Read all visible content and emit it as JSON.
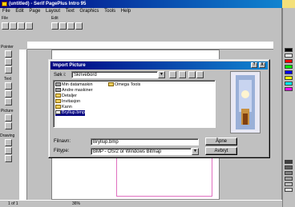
{
  "app": {
    "title": "(untitled) - Serif PagePlus Intro 95",
    "menu": [
      "File",
      "Edit",
      "Page",
      "Layout",
      "Text",
      "Graphics",
      "Tools",
      "Help"
    ],
    "toolbar_groups": [
      "File",
      "Edit"
    ]
  },
  "left_panel": {
    "sections": [
      "Pointer",
      "Text",
      "Picture",
      "Drawing"
    ]
  },
  "status": {
    "page_indicator": "1 of 1",
    "zoom": "36%"
  },
  "dialog": {
    "title": "Import Picture",
    "look_in_label": "Søk i:",
    "look_in_value": "Skrivebord",
    "items": [
      {
        "name": "Min datamaskin",
        "type": "drive"
      },
      {
        "name": "Omega Tools",
        "type": "folder"
      },
      {
        "name": "Andre maskiner",
        "type": "drive"
      },
      {
        "name": "Detaljer",
        "type": "folder"
      },
      {
        "name": "Invitasjon",
        "type": "folder"
      },
      {
        "name": "Kann",
        "type": "folder"
      },
      {
        "name": "Bryllup.bmp",
        "type": "file",
        "selected": true
      }
    ],
    "filename_label": "Filnavn:",
    "filename_value": "Bryllup.bmp",
    "filetype_label": "Filtype:",
    "filetype_value": "BMP - OS/2 or Windows Bitmap",
    "open_button": "Åpne",
    "cancel_button": "Avbryt",
    "help_ctrl": "?",
    "close_ctrl": "X"
  }
}
